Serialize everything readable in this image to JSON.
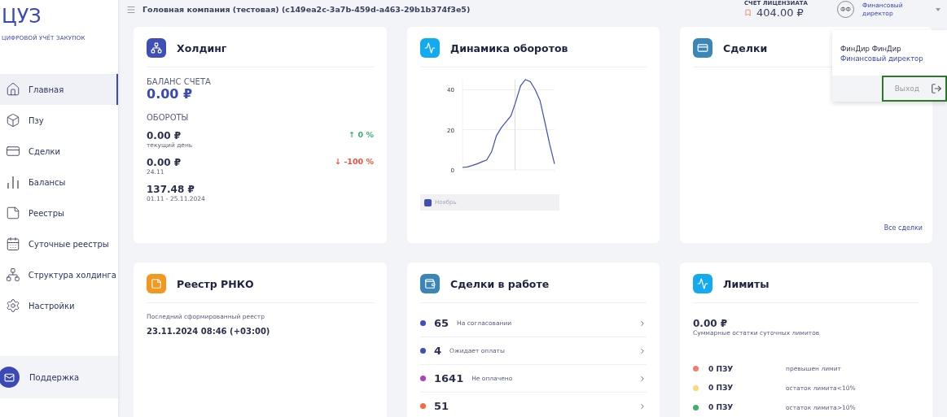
{
  "brand": {
    "logo": "ЦУЗ",
    "tagline": "ЦИФРОВОЙ УЧЁТ ЗАКУПОК"
  },
  "sidebar": {
    "items": [
      {
        "label": "Главная",
        "selected": true
      },
      {
        "label": "Пзу",
        "selected": false
      },
      {
        "label": "Сделки",
        "selected": false
      },
      {
        "label": "Балансы",
        "selected": false
      },
      {
        "label": "Реестры",
        "selected": false
      },
      {
        "label": "Суточные реестры",
        "selected": false
      },
      {
        "label": "Структура холдинга",
        "selected": false
      },
      {
        "label": "Настройки",
        "selected": false
      }
    ],
    "support": "Поддержка"
  },
  "header": {
    "company": "Головная компания (тестовая) (c149ea2c-3a7b-459d-a463-29b1b374f3e5)",
    "license_label": "СЧЕТ ЛИЦЕНЗИАТА",
    "license_amount": "404.00 ₽",
    "user_initials": "ФФ",
    "user_role": "Финансовый директор"
  },
  "user_menu": {
    "name": "ФинДир ФинДир",
    "role": "Финансовый директор",
    "logout": "Выход"
  },
  "cards": [
    {
      "kind": "holding",
      "title": "Холдинг",
      "balance_label": "БАЛАНС СЧЕТА",
      "balance": "0.00 ₽",
      "turnover_label": "ОБОРОТЫ",
      "turnovers": [
        {
          "amount": "0.00 ₽",
          "caption": "текущий день",
          "trend": "↑ 0 %",
          "color": "#3fb06a"
        },
        {
          "amount": "0.00 ₽",
          "caption": "24.11",
          "trend": "↓ -100 %",
          "color": "#f0503c"
        },
        {
          "amount": "137.48 ₽",
          "caption": "01.11 - 25.11.2024"
        }
      ]
    },
    {
      "kind": "chart",
      "title": "Динамика оборотов",
      "chart_data": {
        "type": "line",
        "yticks": [
          0,
          20,
          40
        ],
        "ylim": [
          0,
          45
        ],
        "series": [
          {
            "name": "Ноябрь",
            "color": "#3f4fb8",
            "values": [
              1.2,
              1.5,
              2.2,
              3,
              4,
              5,
              9,
              17,
              21,
              24,
              27,
              34,
              42,
              45,
              44,
              40,
              34.6,
              23.9,
              12.7,
              3
            ]
          }
        ]
      }
    },
    {
      "kind": "deals",
      "title": "Сделки",
      "link": "Все сделки"
    },
    {
      "kind": "registry",
      "title": "Реестр РНКО",
      "caption": "Последний сформированный реестр",
      "value": "23.11.2024 08:46 (+03:00)"
    },
    {
      "kind": "deals_work",
      "title": "Сделки в работе",
      "rows": [
        {
          "count": "65",
          "label": "На согласовании",
          "color": "#3f4fb8"
        },
        {
          "count": "4",
          "label": "Ожидает оплаты",
          "color": "#3f4fb8"
        },
        {
          "count": "1641",
          "label": "Не оплачено",
          "color": "#b040c0"
        },
        {
          "count": "51",
          "color": "#f26a3d"
        }
      ]
    },
    {
      "kind": "limits",
      "title": "Лимиты",
      "amount": "0.00 ₽",
      "caption": "Суммарные остатки суточных лимитов",
      "rows": [
        {
          "count": "0 ПЗУ",
          "label": "превышен лимит",
          "color": "#f47c6c"
        },
        {
          "count": "0 ПЗУ",
          "label": "остаток лимита<10%",
          "color": "#fbd77a"
        },
        {
          "count": "0 ПЗУ",
          "label": "остаток лимита>10%",
          "color": "#3fae6a"
        }
      ]
    }
  ]
}
